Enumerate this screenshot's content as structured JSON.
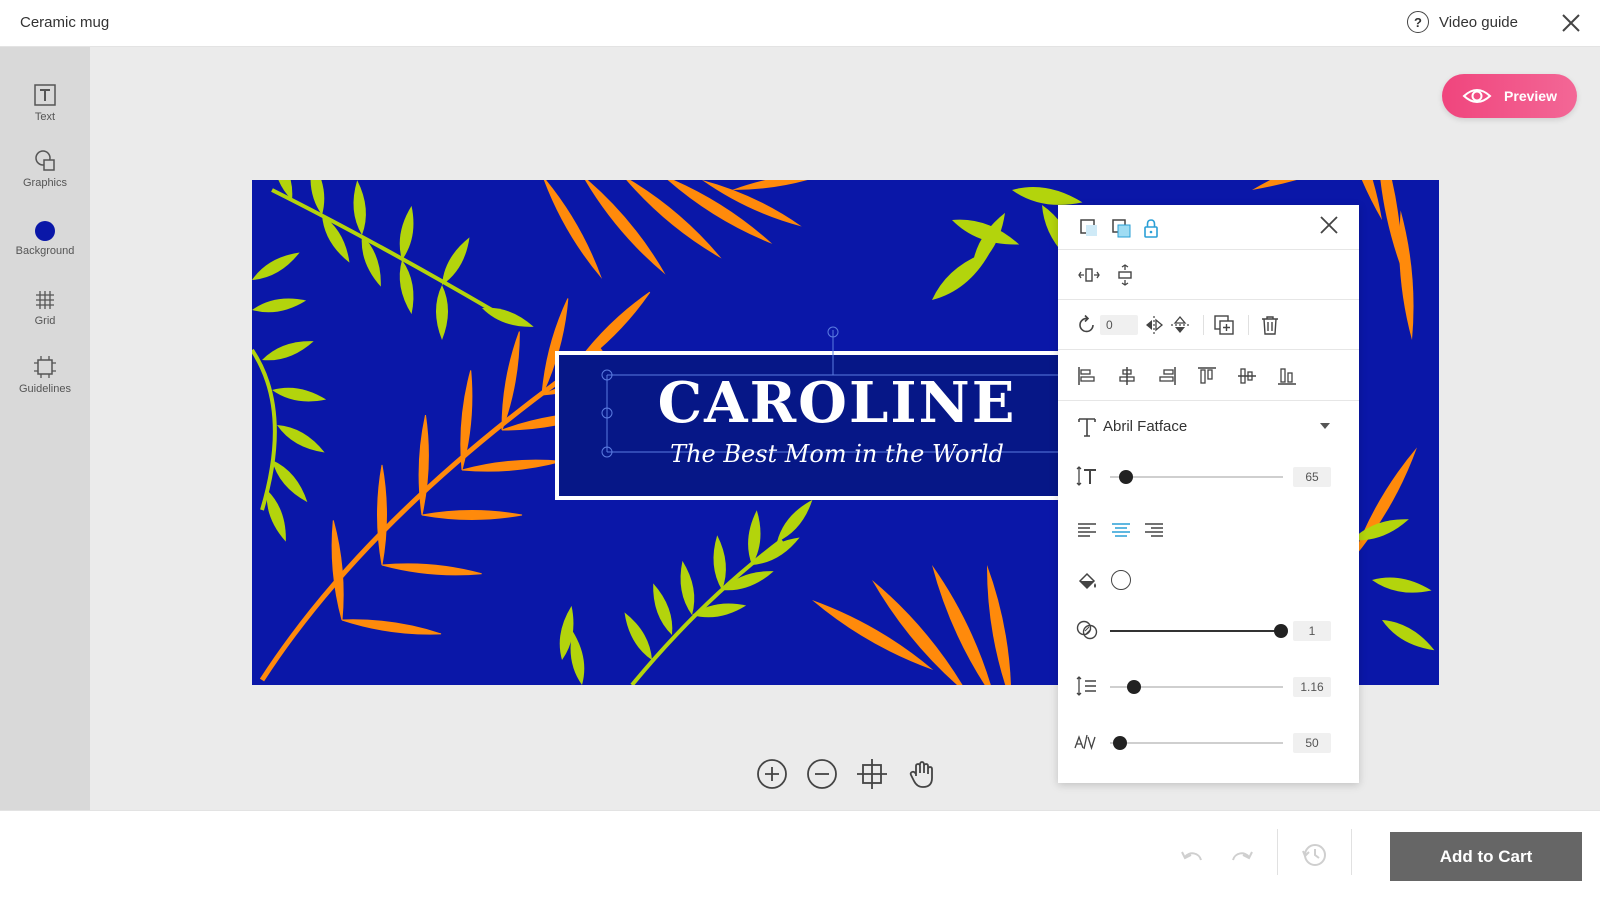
{
  "header": {
    "title": "Ceramic mug",
    "video_guide": "Video guide"
  },
  "sidebar": {
    "items": [
      {
        "label": "Text"
      },
      {
        "label": "Graphics"
      },
      {
        "label": "Background"
      },
      {
        "label": "Grid"
      },
      {
        "label": "Guidelines"
      }
    ],
    "background_color": "#0a17a8"
  },
  "workspace": {
    "preview_label": "Preview"
  },
  "design": {
    "name_text": "CAROLINE",
    "subtitle_text": "The Best Mom in the World",
    "background_color": "#0a17a8",
    "leaf_colors": {
      "orange": "#ff8a0b",
      "green": "#b3d40c"
    }
  },
  "panel": {
    "rotation": "0",
    "font_name": "Abril Fatface",
    "font_size": "65",
    "opacity": "1",
    "line_height": "1.16",
    "letter_spacing": "50",
    "text_align": "center"
  },
  "footer": {
    "add_to_cart": "Add to Cart"
  },
  "colors": {
    "accent": "#2a9fd6",
    "preview_gradient_start": "#f0457d",
    "preview_gradient_end": "#f36796"
  }
}
